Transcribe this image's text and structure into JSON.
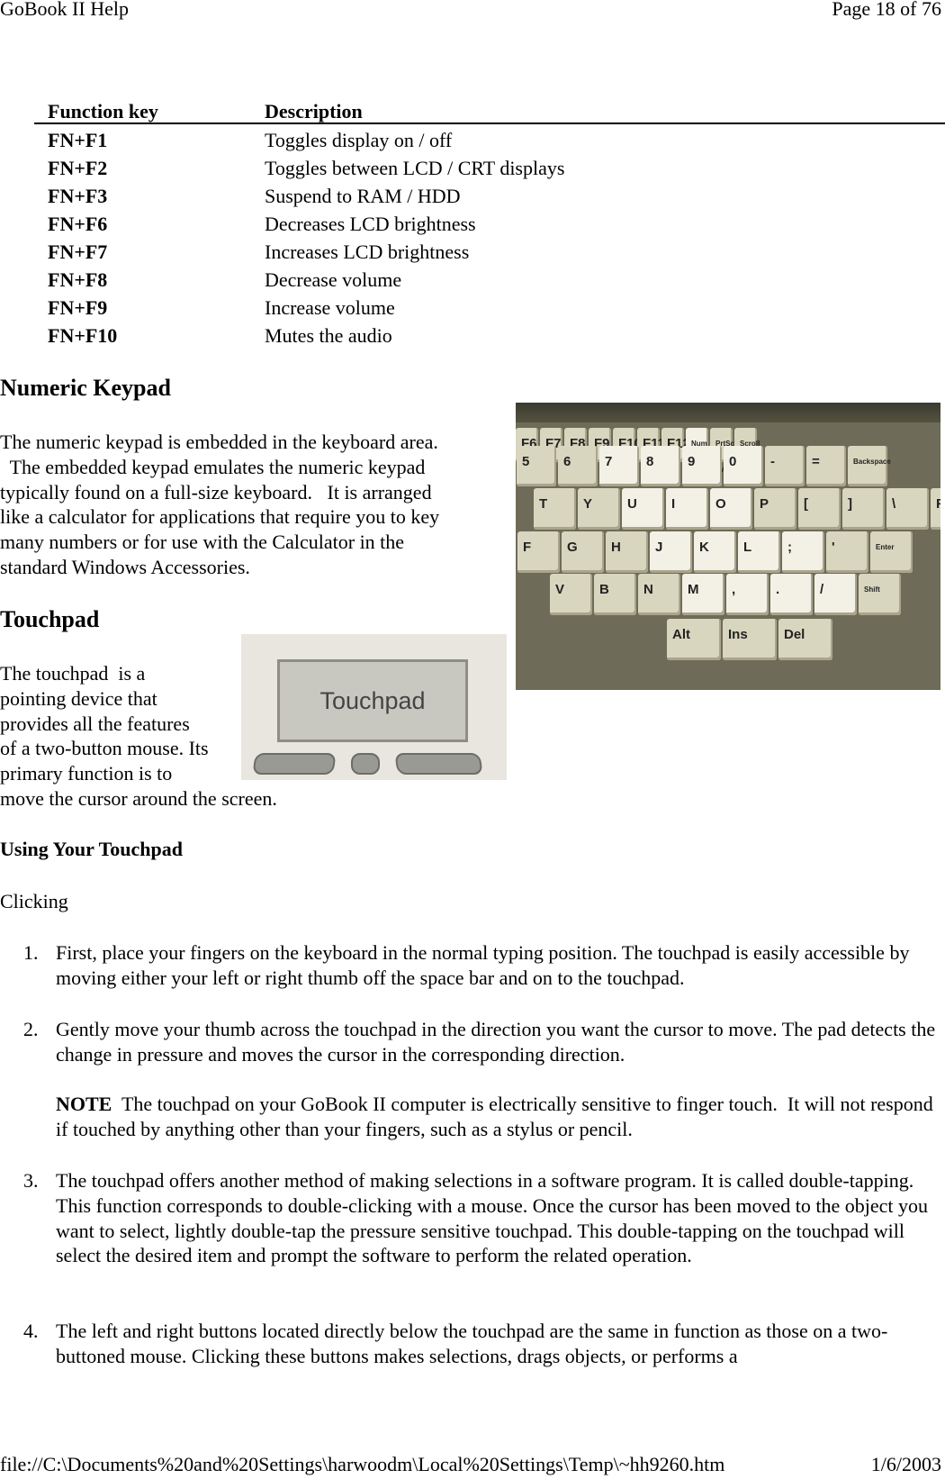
{
  "header": {
    "title": "GoBook II Help",
    "page": "Page 18 of 76"
  },
  "footer": {
    "path": "file://C:\\Documents%20and%20Settings\\harwoodm\\Local%20Settings\\Temp\\~hh9260.htm",
    "date": "1/6/2003"
  },
  "table": {
    "headers": [
      "Function key",
      "Description"
    ],
    "rows": [
      {
        "key": "FN+F1",
        "desc": "Toggles display on / off"
      },
      {
        "key": "FN+F2",
        "desc": "Toggles between LCD / CRT displays"
      },
      {
        "key": "FN+F3",
        "desc": "Suspend to RAM / HDD"
      },
      {
        "key": "FN+F6",
        "desc": "Decreases LCD brightness"
      },
      {
        "key": "FN+F7",
        "desc": "Increases LCD brightness"
      },
      {
        "key": "FN+F8",
        "desc": "Decrease volume"
      },
      {
        "key": "FN+F9",
        "desc": "Increase volume"
      },
      {
        "key": "FN+F10",
        "desc": "Mutes the audio"
      }
    ]
  },
  "keypad": {
    "heading": "Numeric Keypad",
    "lines": [
      "The numeric keypad is embedded in the keyboard area.",
      "  The embedded keypad emulates the numeric keypad",
      "typically found on a full-size keyboard.   It is arranged",
      "like a calculator for applications that require you to key",
      "many numbers or for use with the Calculator in the",
      "standard Windows Accessories."
    ]
  },
  "keyboard_image": {
    "keys": [
      "F6",
      "F7",
      "F8",
      "F9",
      "F10",
      "F11",
      "F12",
      "Num Lock",
      "PrtSc SysRq",
      "Scroll Lock",
      "5",
      "6",
      "7",
      "8",
      "9",
      "0",
      "-",
      "=",
      "Backspace",
      "T",
      "Y",
      "U",
      "I",
      "O",
      "P",
      "[",
      "]",
      "\\",
      "F",
      "G",
      "H",
      "J",
      "K",
      "L",
      ";",
      "'",
      "Enter",
      "V",
      "B",
      "N",
      "M",
      ",",
      ".",
      "/",
      "Shift",
      "Alt",
      "Ins",
      "Del"
    ]
  },
  "touchpad": {
    "heading": "Touchpad",
    "lines": [
      "The touchpad  is a",
      "pointing device that",
      "provides all the features",
      "of a two-button mouse. Its",
      "primary function is to",
      "move the cursor around the screen."
    ],
    "image_label": "Touchpad"
  },
  "using": {
    "heading": "Using Your Touchpad",
    "subheading": "Clicking",
    "items": [
      {
        "num": "1.",
        "text": "First, place your fingers on the keyboard in the normal typing position. The touchpad is easily accessible by moving either your left or right thumb off the space bar and on to the touchpad."
      },
      {
        "num": "2.",
        "text": "Gently move your thumb across the touchpad in the direction you want the cursor to move. The pad detects the change in pressure and moves the cursor in the corresponding direction."
      },
      {
        "num": "3.",
        "text": "The touchpad offers another method of making selections in a software program. It is called double-tapping. This function corresponds to double-clicking with a mouse. Once the cursor has been moved to the object you want to select, lightly double-tap the pressure sensitive touchpad. This double-tapping on the touchpad will select the desired item and prompt the software to perform the related operation."
      },
      {
        "num": "4.",
        "text": "The left and right buttons located directly below the touchpad are the same in function as those on a two-buttoned mouse. Clicking these buttons makes selections, drags objects, or performs a"
      }
    ],
    "note": {
      "label": "NOTE",
      "text": "  The touchpad on your GoBook II computer is electrically sensitive to finger touch.  It will not respond if touched by anything other than your fingers, such as a stylus or pencil."
    }
  }
}
